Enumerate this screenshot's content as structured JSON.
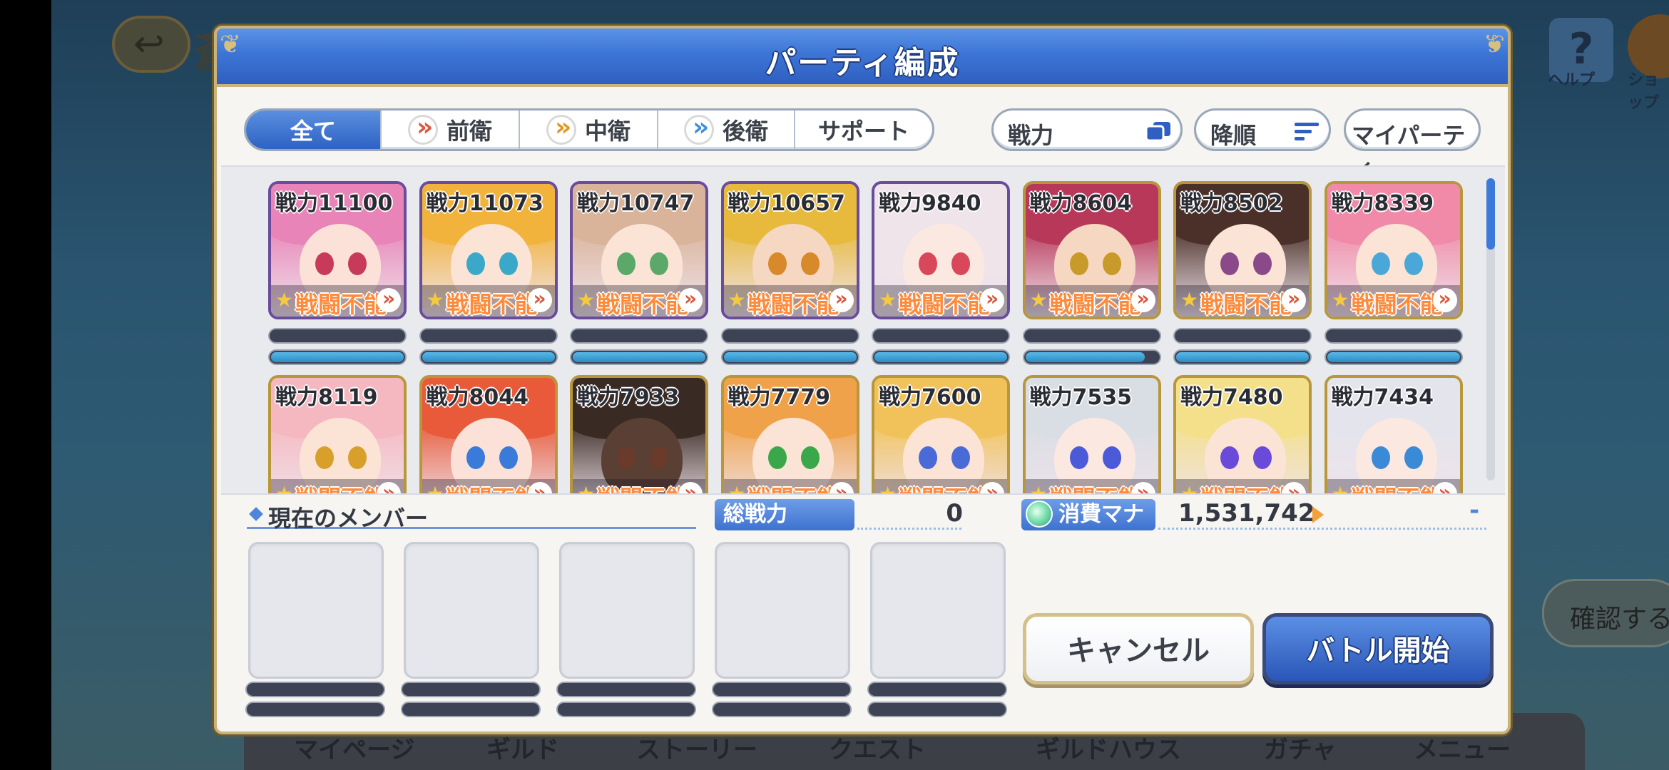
{
  "background": {
    "title": "蒼",
    "help_label": "ヘルプ",
    "shop_label": "ショップ",
    "side_button": "確認する",
    "nav": [
      "マイページ",
      "ギルド",
      "ストーリー",
      "クエスト",
      "ギルドハウス",
      "ガチャ",
      "メニュー"
    ]
  },
  "dialog": {
    "title": "パーティ編成"
  },
  "filter_tabs": [
    {
      "label": "全て",
      "active": true,
      "role": ""
    },
    {
      "label": "前衛",
      "active": false,
      "role": "front"
    },
    {
      "label": "中衛",
      "active": false,
      "role": "mid"
    },
    {
      "label": "後衛",
      "active": false,
      "role": "back"
    },
    {
      "label": "サポート",
      "active": false,
      "role": ""
    }
  ],
  "sort": {
    "key_label": "戦力",
    "order_label": "降順",
    "my_party_label": "マイパーティ"
  },
  "ko_label": "戦闘不能",
  "characters": [
    {
      "power": "戦力11100",
      "frame": "purple",
      "hair": "#e884b8",
      "eye": "#c83a5a",
      "skin": "#fbe1d8",
      "tp": 1.0
    },
    {
      "power": "戦力11073",
      "frame": "purple",
      "hair": "#f2b33c",
      "eye": "#3aa8c8",
      "skin": "#fbe4d6",
      "tp": 1.0
    },
    {
      "power": "戦力10747",
      "frame": "purple",
      "hair": "#d9b39a",
      "eye": "#5aa86a",
      "skin": "#fbe4d6",
      "tp": 1.0
    },
    {
      "power": "戦力10657",
      "frame": "purple",
      "hair": "#e7b93c",
      "eye": "#d88a2a",
      "skin": "#f6d7c2",
      "tp": 1.0
    },
    {
      "power": "戦力9840",
      "frame": "purple",
      "hair": "#eee4ea",
      "eye": "#d8485a",
      "skin": "#fbe8e0",
      "tp": 1.0
    },
    {
      "power": "戦力8604",
      "frame": "gold",
      "hair": "#b8385a",
      "eye": "#c89a2a",
      "skin": "#f6d7c2",
      "tp": 0.9
    },
    {
      "power": "戦力8502",
      "frame": "gold",
      "hair": "#4a3028",
      "eye": "#8a4a8a",
      "skin": "#fbe4d6",
      "tp": 1.0
    },
    {
      "power": "戦力8339",
      "frame": "gold",
      "hair": "#f08aa8",
      "eye": "#4aa8d8",
      "skin": "#fbe4d6",
      "tp": 1.0
    },
    {
      "power": "戦力8119",
      "frame": "gold",
      "hair": "#f6b8c0",
      "eye": "#d8a02a",
      "skin": "#fbe4d6",
      "tp": 1.0
    },
    {
      "power": "戦力8044",
      "frame": "gold",
      "hair": "#e85a3a",
      "eye": "#3a7ad8",
      "skin": "#fbe1d8",
      "tp": 1.0
    },
    {
      "power": "戦力7933",
      "frame": "gold",
      "hair": "#3a2a24",
      "eye": "#6a3a2a",
      "skin": "#5a4034",
      "tp": 1.0
    },
    {
      "power": "戦力7779",
      "frame": "gold",
      "hair": "#f0a24a",
      "eye": "#3aa84a",
      "skin": "#fbe4d6",
      "tp": 1.0
    },
    {
      "power": "戦力7600",
      "frame": "gold",
      "hair": "#f2c25a",
      "eye": "#4a6ad8",
      "skin": "#fbe4d6",
      "tp": 1.0
    },
    {
      "power": "戦力7535",
      "frame": "gold",
      "hair": "#d9dde4",
      "eye": "#4a5ad8",
      "skin": "#fbe8e0",
      "tp": 1.0
    },
    {
      "power": "戦力7480",
      "frame": "gold",
      "hair": "#f4e08a",
      "eye": "#6a4ad8",
      "skin": "#fbe4d6",
      "tp": 1.0
    },
    {
      "power": "戦力7434",
      "frame": "gold",
      "hair": "#e4e4ec",
      "eye": "#3a8ad8",
      "skin": "#fbe8e0",
      "tp": 1.0
    }
  ],
  "members": {
    "header": "現在のメンバー",
    "slots": 5,
    "total_power_label": "総戦力",
    "total_power_value": "0",
    "mana_label": "消費マナ",
    "mana_value": "1,531,742",
    "mana_minus": "-"
  },
  "buttons": {
    "cancel": "キャンセル",
    "start": "バトル開始"
  },
  "colors": {
    "header_blue": "#3d75d6",
    "gold_border": "#c9b37a",
    "ko_orange": "#ff8a3a",
    "purple_frame": "#6a4c9c",
    "gold_frame": "#b8973c"
  }
}
